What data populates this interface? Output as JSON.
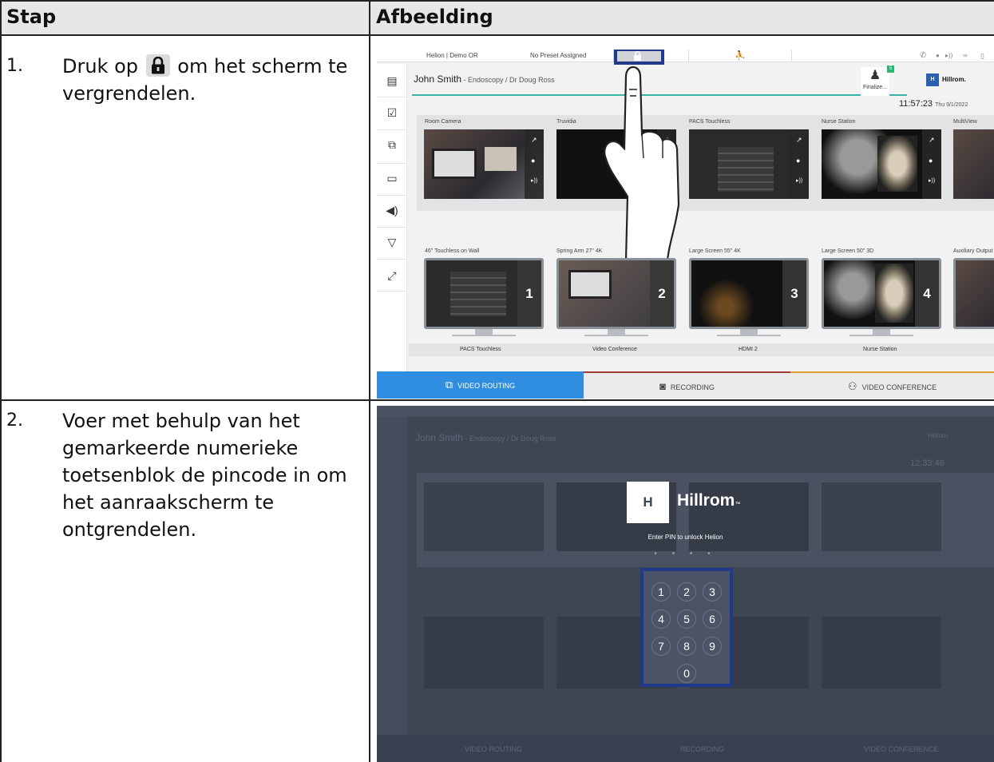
{
  "table": {
    "col_step": "Stap",
    "col_image": "Afbeelding"
  },
  "rows": [
    {
      "num": "1.",
      "text_before": "Druk op",
      "text_after": "om het scherm te vergrendelen."
    },
    {
      "num": "2.",
      "text": "Voer met behulp van het gemarkeerde numerieke toetsenblok de pincode in om het aanraakscherm te ontgrendelen."
    }
  ],
  "screen1": {
    "room": "Helion | Demo OR",
    "preset": "No Preset Assigned",
    "patient_name": "John Smith",
    "patient_detail": " - Endoscopy / Dr Doug Ross",
    "finalize": "Finalize...",
    "badge": "5",
    "brand": "Hillrom.",
    "brand_mark": "H",
    "time": "11:57:23",
    "date": "Thu 9/1/2022",
    "sources": [
      "Room Camera",
      "Truvidia",
      "PACS Touchless",
      "Nurse Station",
      "MultiView"
    ],
    "destinations": [
      "46\" Touchless on Wall",
      "Spring Arm 27\" 4K",
      "Large Screen 55\" 4K",
      "Large Screen 50\" 3D",
      "Auxiliary Output"
    ],
    "monitor_numbers": [
      "1",
      "2",
      "3",
      "4"
    ],
    "assigned": [
      "PACS Touchless",
      "Video Conference",
      "HDMI 2",
      "Nurse Station"
    ],
    "tabs": {
      "routing": "VIDEO ROUTING",
      "recording": "RECORDING",
      "conference": "VIDEO CONFERENCE"
    },
    "colors": {
      "routing": "#2f8ee0",
      "recording": "#a23a3a",
      "conference": "#e0a030",
      "accent_line": "#3bb6a6",
      "highlight": "#1f3a8a"
    }
  },
  "screen2": {
    "brand": "Hillrom",
    "brand_tm": "™",
    "brand_mark": "H",
    "pin_caption": "Enter PIN to unlock Helion",
    "pin_dots": "• • • •",
    "keys": [
      "1",
      "2",
      "3",
      "4",
      "5",
      "6",
      "7",
      "8",
      "9",
      "0"
    ],
    "background_time": "12:33:46",
    "background_patient": "John Smith",
    "background_patient_detail": " - Endoscopy / Dr Doug Ross",
    "background_brand": "Hillrom",
    "background_tabs": [
      "VIDEO ROUTING",
      "RECORDING",
      "VIDEO CONFERENCE"
    ]
  }
}
